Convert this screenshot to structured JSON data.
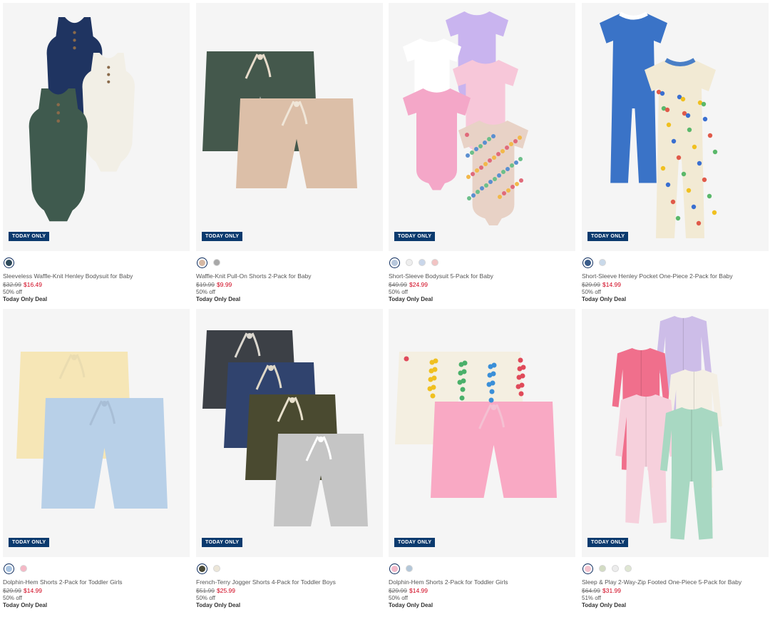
{
  "badge_text": "TODAY ONLY",
  "products": [
    {
      "name": "Sleeveless Waffle-Knit Henley Bodysuit for Baby",
      "was": "$32.99",
      "now": "$16.49",
      "off": "50% off",
      "deal": "Today Only Deal",
      "swatches": [
        "#2e4a5a"
      ],
      "icon": "bodysuit-3pack-image"
    },
    {
      "name": "Waffle-Knit Pull-On Shorts 2-Pack for Baby",
      "was": "$19.99",
      "now": "$9.99",
      "off": "50% off",
      "deal": "Today Only Deal",
      "swatches": [
        "#d6b8a3",
        "#a8a8a8"
      ],
      "icon": "shorts-2pack-image"
    },
    {
      "name": "Short-Sleeve Bodysuit 5-Pack for Baby",
      "was": "$49.99",
      "now": "$24.99",
      "off": "50% off",
      "deal": "Today Only Deal",
      "swatches": [
        "#b7c7dc",
        "#eeeeee",
        "#c9d6ea",
        "#f2c4c4"
      ],
      "icon": "bodysuit-5pack-image"
    },
    {
      "name": "Short-Sleeve Henley Pocket One-Piece 2-Pack for Baby",
      "was": "$29.99",
      "now": "$14.99",
      "off": "50% off",
      "deal": "Today Only Deal",
      "swatches": [
        "#3a5c8a",
        "#c9d9ea"
      ],
      "icon": "one-piece-2pack-image"
    },
    {
      "name": "Dolphin-Hem Shorts 2-Pack for Toddler Girls",
      "was": "$29.99",
      "now": "$14.99",
      "off": "50% off",
      "deal": "Today Only Deal",
      "swatches": [
        "#a9c4e2",
        "#f5b8c6"
      ],
      "icon": "dolphin-shorts-image"
    },
    {
      "name": "French-Terry Jogger Shorts 4-Pack for Toddler Boys",
      "was": "$51.99",
      "now": "$25.99",
      "off": "50% off",
      "deal": "Today Only Deal",
      "swatches": [
        "#4a4a38",
        "#ece6d8"
      ],
      "icon": "jogger-shorts-4pack-image"
    },
    {
      "name": "Dolphin-Hem Shorts 2-Pack for Toddler Girls",
      "was": "$29.99",
      "now": "$14.99",
      "off": "50% off",
      "deal": "Today Only Deal",
      "swatches": [
        "#f2b8c9",
        "#b3c7d9"
      ],
      "icon": "dolphin-shorts-pink-image"
    },
    {
      "name": "Sleep & Play 2-Way-Zip Footed One-Piece 5-Pack for Baby",
      "was": "$64.99",
      "now": "$31.99",
      "off": "51% off",
      "deal": "Today Only Deal",
      "swatches": [
        "#f5c4cf",
        "#d3dcc3",
        "#ececec",
        "#dfe6d3"
      ],
      "icon": "sleep-play-5pack-image"
    }
  ]
}
